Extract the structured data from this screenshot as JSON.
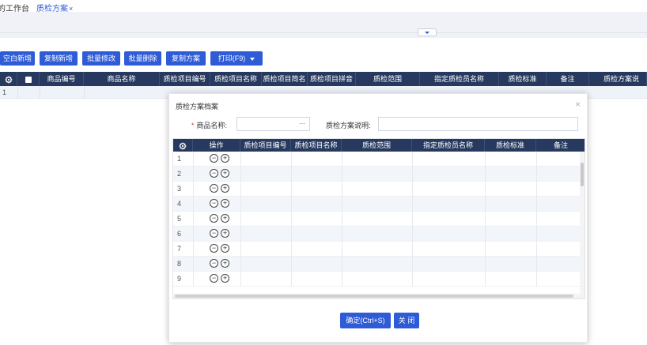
{
  "tabs": [
    {
      "label": "的工作台",
      "active": false
    },
    {
      "label": "质检方案",
      "active": true,
      "close": "×"
    }
  ],
  "toolbar": {
    "buttons": [
      "空白新增",
      "复制新增",
      "批量修改",
      "批量删除",
      "复制方案"
    ],
    "print": "打印(F9)"
  },
  "grid": {
    "columns": [
      "商品编号",
      "商品名称",
      "质检项目编号",
      "质检项目名称",
      "质检项目简名",
      "质检项目拼音",
      "质检范围",
      "指定质检员名称",
      "质检标准",
      "备注",
      "质检方案说"
    ],
    "row_number": "1"
  },
  "modal": {
    "title": "质检方案档案",
    "close": "×",
    "product_label": "商品名称:",
    "product_value": "",
    "product_dots": "···",
    "desc_label": "质检方案说明:",
    "desc_value": "",
    "columns": [
      "操作",
      "质检项目编号",
      "质检项目名称",
      "质检范围",
      "指定质检员名称",
      "质检标准",
      "备注"
    ],
    "rows": [
      "1",
      "2",
      "3",
      "4",
      "5",
      "6",
      "7",
      "8",
      "9"
    ],
    "op_remove": "−",
    "op_add": "+",
    "confirm": "确定(Ctrl+S)",
    "close_btn": "关 闭"
  },
  "colors": {
    "primary": "#2e5bd6",
    "header": "#27395f",
    "required": "#e5312a"
  }
}
